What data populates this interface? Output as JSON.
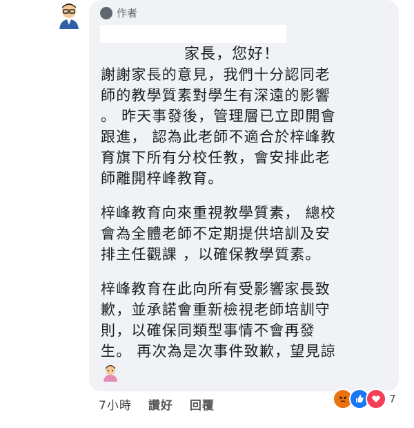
{
  "comment": {
    "author_badge": "作者",
    "greeting": "家長，您好！",
    "paragraphs": [
      {
        "lines": [
          "謝謝家長的意見，我們十分認同老",
          "師的教學質素對學生有深遠的影響",
          "。 昨天事發後，管理層已立即開會",
          "跟進， 認為此老師不適合於梓峰教",
          "育旗下所有分校任教，會安排此老",
          "師離開梓峰教育。"
        ]
      },
      {
        "lines": [
          "梓峰教育向來重視教學質素， 總校",
          "會為全體老師不定期提供培訓及安",
          "排主任觀課 ，以確保教學質素。"
        ]
      },
      {
        "lines": [
          "梓峰教育在此向所有受影響家長致",
          "歉，並承諾會重新檢視老師培訓守",
          "則，以確保同類型事情不會再發",
          "生。 再次為是次事件致歉，望見諒"
        ]
      }
    ]
  },
  "meta": {
    "time": "7小時",
    "like_label": "讚好",
    "reply_label": "回覆"
  },
  "reactions": {
    "icons": [
      "angry-icon",
      "like-icon",
      "love-icon"
    ],
    "count": "7"
  },
  "colors": {
    "bubble": "#f0f2f5",
    "angry": "#e9710f",
    "like": "#1877f2",
    "love": "#f33e58"
  }
}
